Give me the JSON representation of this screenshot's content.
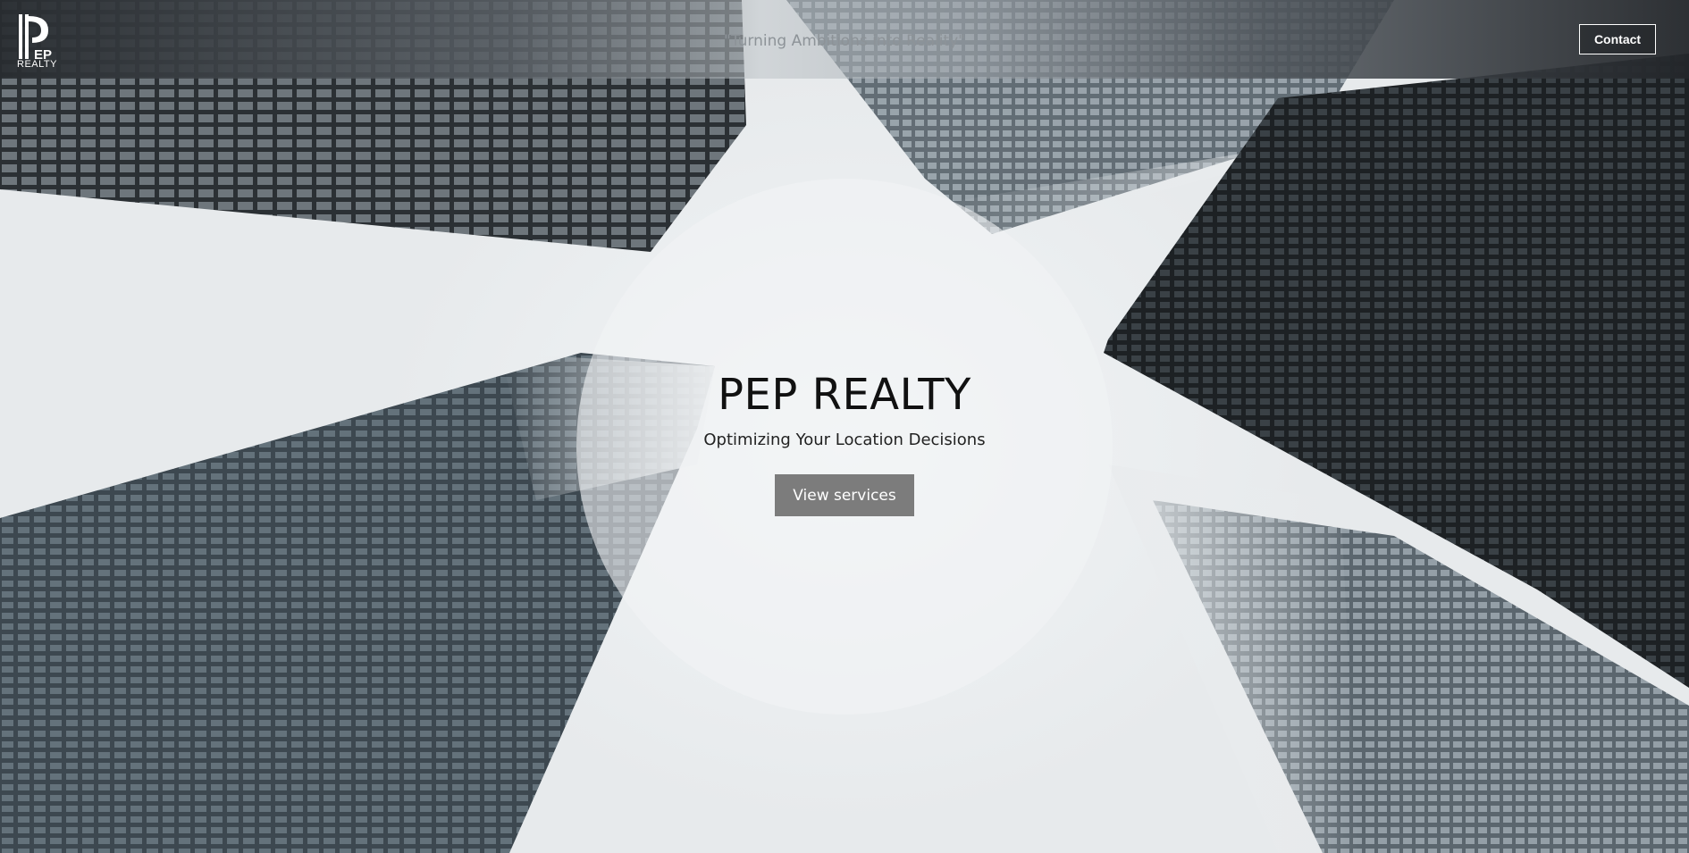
{
  "brand": {
    "logo_text": "REALTY"
  },
  "header": {
    "tagline": "\"Turning Ambitions into Reality\"",
    "contact_label": "Contact"
  },
  "hero": {
    "title": "PEP REALTY",
    "subtitle": "Optimizing Your Location Decisions",
    "cta_label": "View services"
  },
  "colors": {
    "cta_bg": "#7c7c7c",
    "title": "#111111",
    "tagline": "#8d9398"
  }
}
